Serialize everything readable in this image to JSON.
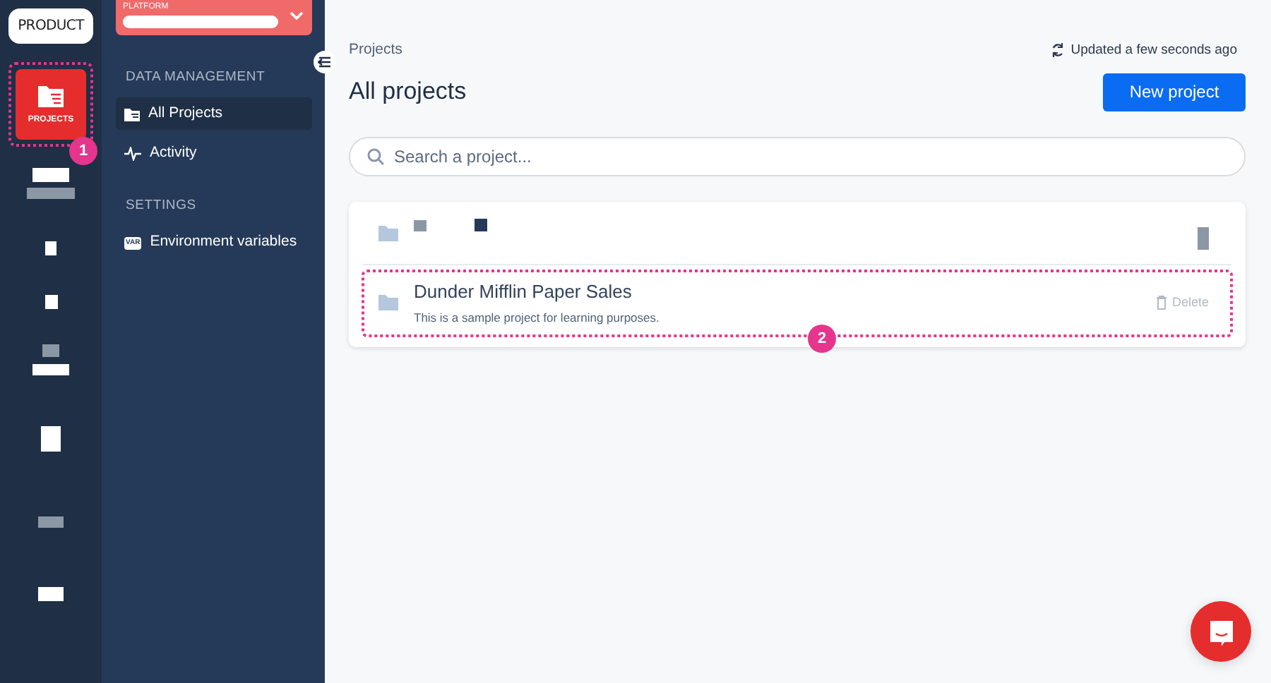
{
  "rail": {
    "logo": "PRODUCT",
    "items": [
      {
        "label": "PROJECTS",
        "selected": true,
        "callout": "1"
      }
    ]
  },
  "sidebar": {
    "dropdown": {
      "label": "PLATFORM"
    },
    "sections": [
      {
        "title": "DATA MANAGEMENT",
        "items": [
          {
            "label": "All Projects",
            "kind": "folder",
            "selected": true
          },
          {
            "label": "Activity",
            "kind": "pulse",
            "selected": false
          }
        ]
      },
      {
        "title": "SETTINGS",
        "items": [
          {
            "label": "Environment variables",
            "kind": "tag",
            "icon_text": "VAR",
            "selected": false
          }
        ]
      }
    ]
  },
  "main": {
    "breadcrumb": "Projects",
    "status": "Updated a few seconds ago",
    "title": "All projects",
    "new_button": "New project",
    "search": {
      "placeholder": "Search a project..."
    },
    "projects": [
      {
        "name": "Dunder Mifflin Paper Sales",
        "description": "This is a sample project for learning purposes.",
        "action": "Delete",
        "callout": "2"
      }
    ]
  }
}
